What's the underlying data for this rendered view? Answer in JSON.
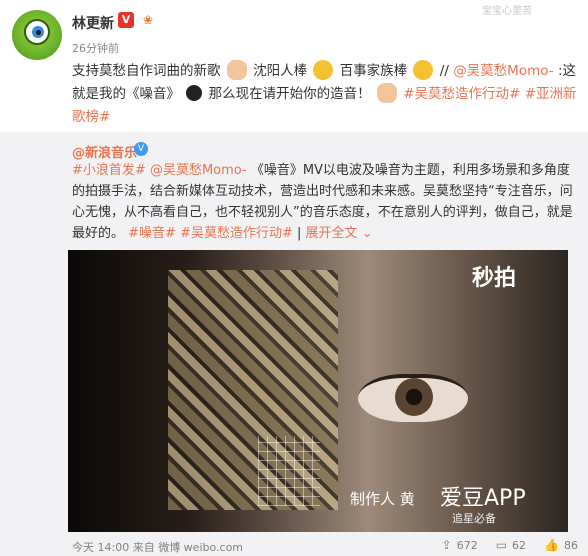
{
  "post": {
    "username": "林更新",
    "vip_badge": "V",
    "time": "26分钟前",
    "watermark": "宝宝心里苦",
    "text": {
      "part1": "支持莫愁自作词曲的新歌",
      "part2": " 沈阳人棒",
      "part3": " 百事家族棒",
      "part4": " //",
      "mention": "@吴莫愁Momo-",
      "part5": ":这就是我的《噪音》",
      "part6": " 那么现在请开始你的造音！",
      "hashtag1": "#吴莫愁造作行动#",
      "hashtag2": "#亚洲新歌榜#"
    }
  },
  "repost": {
    "author": "@新浪音乐",
    "text": {
      "hashtag1": "#小浪首发#",
      "mention": "@吴莫愁Momo-",
      "body": "《噪音》MV以电波及噪音为主题，利用多场景和多角度的拍摄手法，结合新媒体互动技术，营造出时代感和未来感。吴莫愁坚持“专注音乐，问心无愧，从不高看自己，也不轻视别人”的音乐态度，不在意别人的评判，做自己，就是最好的。",
      "hashtag2": "#噪音#",
      "hashtag3": "#吴莫愁造作行动#",
      "more": "展开全文",
      "more_arrow": "⌄"
    },
    "video": {
      "platform_logo": "秒拍",
      "credit": "制作人",
      "credit_name": "黄",
      "app_watermark": "爱豆APP",
      "tagline": "追星必备"
    }
  },
  "footer": {
    "source": "今天 14:00 来自 微博 weibo.com",
    "repost_count": "672",
    "comment_count": "62",
    "like_count": "86"
  },
  "colors": {
    "link": "#eb7350",
    "background": "#f2f2f5",
    "vip": "#e9332a",
    "verified": "#3b9cf2"
  }
}
